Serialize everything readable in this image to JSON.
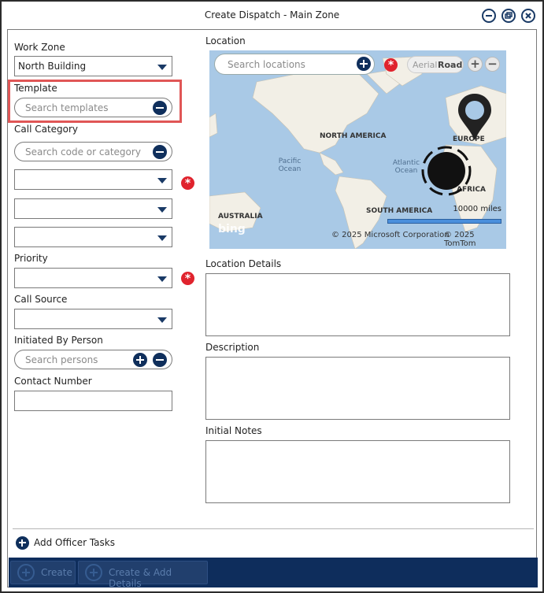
{
  "window": {
    "title": "Create Dispatch - Main Zone"
  },
  "form": {
    "work_zone": {
      "label": "Work Zone",
      "value": "North Building"
    },
    "template": {
      "label": "Template",
      "placeholder": "Search templates"
    },
    "call_category": {
      "label": "Call Category",
      "placeholder": "Search code or category"
    },
    "priority": {
      "label": "Priority",
      "value": ""
    },
    "call_source": {
      "label": "Call Source",
      "value": ""
    },
    "initiated_by": {
      "label": "Initiated By Person",
      "placeholder": "Search persons"
    },
    "contact_number": {
      "label": "Contact Number",
      "value": ""
    }
  },
  "location": {
    "label": "Location",
    "search_placeholder": "Search locations",
    "map": {
      "toggle_aerial": "Aerial",
      "toggle_road": "Road",
      "labels": {
        "north_america": "NORTH AMERICA",
        "europe": "EUROPE",
        "africa": "AFRICA",
        "south_america": "SOUTH AMERICA",
        "australia": "AUSTRALIA",
        "pacific": "Pacific\nOcean",
        "atlantic": "Atlantic\nOcean"
      },
      "scale": "10000 miles",
      "copyright_ms": "© 2025 Microsoft Corporation",
      "copyright_tt": "© 2025 TomTom",
      "bing": "bing"
    }
  },
  "location_details": {
    "label": "Location Details"
  },
  "description": {
    "label": "Description"
  },
  "initial_notes": {
    "label": "Initial Notes"
  },
  "add_officer_tasks": "Add Officer Tasks",
  "footer": {
    "create": "Create",
    "create_add_details": "Create & Add Details"
  },
  "colors": {
    "accent": "#0f2f5c",
    "required": "#e0232d",
    "highlight": "#e05656",
    "map_water": "#a9c9e6"
  }
}
